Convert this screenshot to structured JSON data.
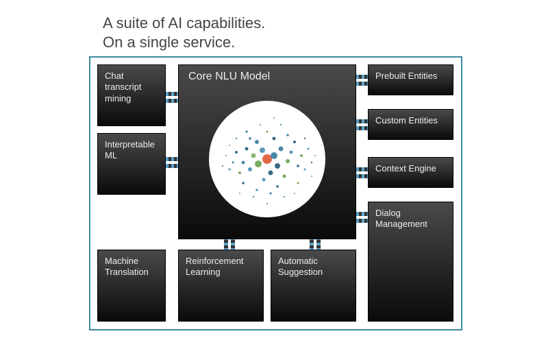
{
  "heading": {
    "line1": "A suite of AI capabilities.",
    "line2": "On a single service."
  },
  "core": {
    "title": "Core NLU Model"
  },
  "tiles": {
    "chat_mining": "Chat transcript mining",
    "interpretable_ml": "Interpretable ML",
    "machine_translation": "Machine Translation",
    "reinforcement_learning": "Reinforcement Learning",
    "automatic_suggestion": "Automatic Suggestion",
    "prebuilt_entities": "Prebuilt Entities",
    "custom_entities": "Custom Entities",
    "context_engine": "Context Engine",
    "dialog_management": "Dialog Management"
  },
  "colors": {
    "panel_border": "#3a8aa0",
    "tile_text": "#eeeeee",
    "heading_text": "#444444"
  }
}
